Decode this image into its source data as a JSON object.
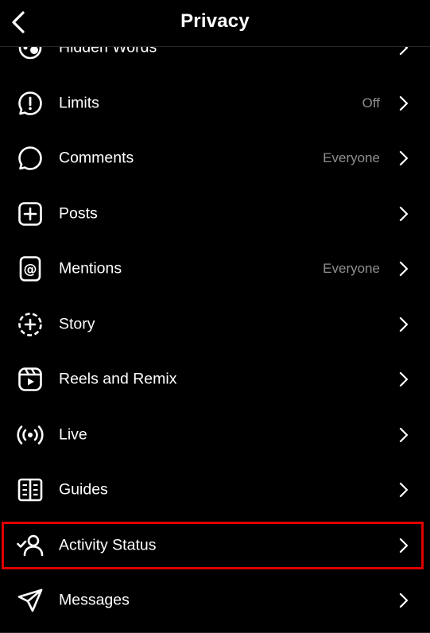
{
  "header": {
    "title": "Privacy",
    "back_icon": "chevron-left-icon"
  },
  "rows": [
    {
      "label": "Hidden Words",
      "value": "",
      "icon": "hidden-words-icon"
    },
    {
      "label": "Limits",
      "value": "Off",
      "icon": "limits-icon"
    },
    {
      "label": "Comments",
      "value": "Everyone",
      "icon": "comment-icon"
    },
    {
      "label": "Posts",
      "value": "",
      "icon": "posts-icon"
    },
    {
      "label": "Mentions",
      "value": "Everyone",
      "icon": "at-icon"
    },
    {
      "label": "Story",
      "value": "",
      "icon": "story-icon"
    },
    {
      "label": "Reels and Remix",
      "value": "",
      "icon": "reels-icon"
    },
    {
      "label": "Live",
      "value": "",
      "icon": "live-icon"
    },
    {
      "label": "Guides",
      "value": "",
      "icon": "guides-icon"
    },
    {
      "label": "Activity Status",
      "value": "",
      "icon": "activity-status-icon"
    },
    {
      "label": "Messages",
      "value": "",
      "icon": "messages-icon"
    }
  ],
  "highlighted_row": "Activity Status",
  "colors": {
    "background": "#000000",
    "text": "#ffffff",
    "secondary_text": "#8e8e8e",
    "highlight": "#e00000"
  }
}
